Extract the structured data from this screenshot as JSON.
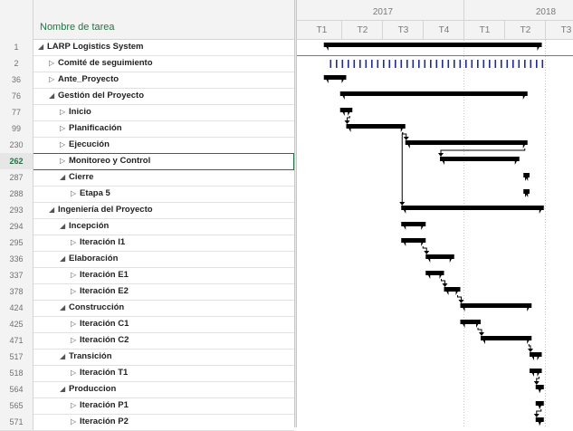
{
  "table": {
    "column_title": "Nombre de tarea",
    "selected_row": 7,
    "rows": [
      {
        "id": "1",
        "name": "LARP Logistics System",
        "level": 0,
        "state": "expanded"
      },
      {
        "id": "2",
        "name": "Comité de seguimiento",
        "level": 1,
        "state": "collapsed"
      },
      {
        "id": "36",
        "name": "Ante_Proyecto",
        "level": 1,
        "state": "collapsed"
      },
      {
        "id": "76",
        "name": "Gestión del Proyecto",
        "level": 1,
        "state": "expanded"
      },
      {
        "id": "77",
        "name": "Inicio",
        "level": 2,
        "state": "collapsed"
      },
      {
        "id": "99",
        "name": "Planificación",
        "level": 2,
        "state": "collapsed"
      },
      {
        "id": "230",
        "name": "Ejecución",
        "level": 2,
        "state": "collapsed"
      },
      {
        "id": "262",
        "name": "Monitoreo y Control",
        "level": 2,
        "state": "collapsed"
      },
      {
        "id": "287",
        "name": "Cierre",
        "level": 2,
        "state": "expanded"
      },
      {
        "id": "288",
        "name": "Etapa 5",
        "level": 3,
        "state": "collapsed"
      },
      {
        "id": "293",
        "name": "Ingeniería del Proyecto",
        "level": 1,
        "state": "expanded"
      },
      {
        "id": "294",
        "name": "Incepción",
        "level": 2,
        "state": "expanded"
      },
      {
        "id": "295",
        "name": "Iteración I1",
        "level": 3,
        "state": "collapsed"
      },
      {
        "id": "336",
        "name": "Elaboración",
        "level": 2,
        "state": "expanded"
      },
      {
        "id": "337",
        "name": "Iteración E1",
        "level": 3,
        "state": "collapsed"
      },
      {
        "id": "378",
        "name": "Iteración E2",
        "level": 3,
        "state": "collapsed"
      },
      {
        "id": "424",
        "name": "Construcción",
        "level": 2,
        "state": "expanded"
      },
      {
        "id": "425",
        "name": "Iteración C1",
        "level": 3,
        "state": "collapsed"
      },
      {
        "id": "471",
        "name": "Iteración C2",
        "level": 3,
        "state": "collapsed"
      },
      {
        "id": "517",
        "name": "Transición",
        "level": 2,
        "state": "expanded"
      },
      {
        "id": "518",
        "name": "Iteración T1",
        "level": 3,
        "state": "collapsed"
      },
      {
        "id": "564",
        "name": "Produccion",
        "level": 2,
        "state": "expanded"
      },
      {
        "id": "565",
        "name": "Iteración P1",
        "level": 3,
        "state": "collapsed"
      },
      {
        "id": "571",
        "name": "Iteración P2",
        "level": 3,
        "state": "collapsed"
      }
    ]
  },
  "timeline": {
    "years": [
      "2017",
      "2018"
    ],
    "quarters": [
      "T1",
      "T2",
      "T3",
      "T4",
      "T1",
      "T2",
      "T3"
    ]
  },
  "gantt": {
    "comment": "start/end in quarter units from start of 2017 T1",
    "bars": [
      {
        "row": 0,
        "start": 0.55,
        "end": 5.9,
        "type": "summary"
      },
      {
        "row": 1,
        "start": 0.7,
        "end": 5.9,
        "type": "recurring"
      },
      {
        "row": 2,
        "start": 0.55,
        "end": 1.1,
        "type": "summary"
      },
      {
        "row": 3,
        "start": 0.95,
        "end": 5.55,
        "type": "summary"
      },
      {
        "row": 4,
        "start": 0.95,
        "end": 1.25,
        "type": "summary"
      },
      {
        "row": 5,
        "start": 1.1,
        "end": 2.55,
        "type": "summary"
      },
      {
        "row": 6,
        "start": 2.55,
        "end": 5.55,
        "type": "summary"
      },
      {
        "row": 7,
        "start": 3.4,
        "end": 5.35,
        "type": "summary"
      },
      {
        "row": 8,
        "start": 5.45,
        "end": 5.6,
        "type": "summary"
      },
      {
        "row": 9,
        "start": 5.45,
        "end": 5.6,
        "type": "summary"
      },
      {
        "row": 10,
        "start": 2.45,
        "end": 5.95,
        "type": "summary"
      },
      {
        "row": 11,
        "start": 2.45,
        "end": 3.05,
        "type": "summary"
      },
      {
        "row": 12,
        "start": 2.45,
        "end": 3.05,
        "type": "summary"
      },
      {
        "row": 13,
        "start": 3.05,
        "end": 3.75,
        "type": "summary"
      },
      {
        "row": 14,
        "start": 3.05,
        "end": 3.5,
        "type": "summary"
      },
      {
        "row": 15,
        "start": 3.5,
        "end": 3.9,
        "type": "summary"
      },
      {
        "row": 16,
        "start": 3.9,
        "end": 5.65,
        "type": "summary"
      },
      {
        "row": 17,
        "start": 3.9,
        "end": 4.4,
        "type": "summary"
      },
      {
        "row": 18,
        "start": 4.4,
        "end": 5.65,
        "type": "summary"
      },
      {
        "row": 19,
        "start": 5.6,
        "end": 5.9,
        "type": "summary"
      },
      {
        "row": 20,
        "start": 5.6,
        "end": 5.9,
        "type": "summary"
      },
      {
        "row": 21,
        "start": 5.75,
        "end": 5.95,
        "type": "summary"
      },
      {
        "row": 22,
        "start": 5.75,
        "end": 5.95,
        "type": "summary"
      },
      {
        "row": 23,
        "start": 5.75,
        "end": 5.95,
        "type": "summary"
      }
    ],
    "links": [
      {
        "from": 4,
        "to": 5
      },
      {
        "from": 5,
        "to": 6
      },
      {
        "from": 5,
        "to": 10
      },
      {
        "from": 6,
        "to": 7
      },
      {
        "from": 12,
        "to": 13
      },
      {
        "from": 14,
        "to": 15
      },
      {
        "from": 15,
        "to": 16
      },
      {
        "from": 17,
        "to": 18
      },
      {
        "from": 18,
        "to": 19
      },
      {
        "from": 20,
        "to": 21
      },
      {
        "from": 22,
        "to": 23
      }
    ],
    "colors": {
      "bar": "#000000",
      "recurring": "#1f2b8f",
      "grid": "#c8c8c8",
      "header": "#f3f3f3"
    }
  }
}
